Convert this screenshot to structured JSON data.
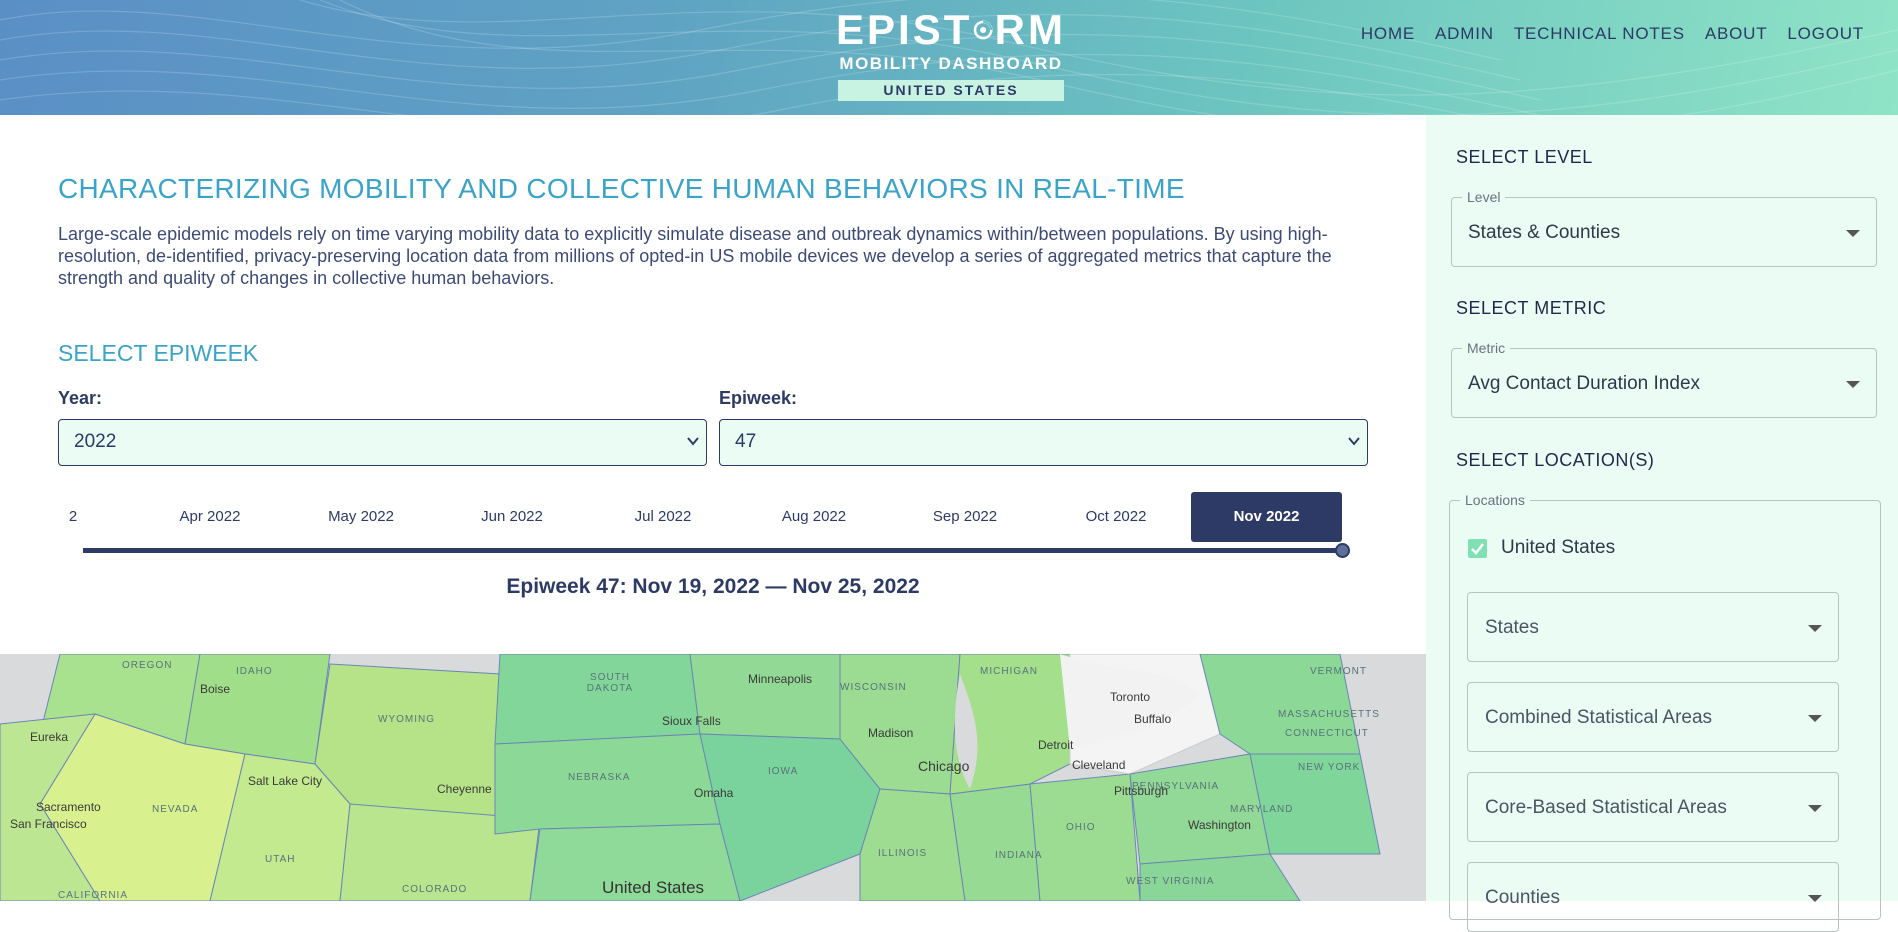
{
  "header": {
    "logo_title_left": "EPIST",
    "logo_title_right": "RM",
    "logo_subtitle": "MOBILITY DASHBOARD",
    "logo_country": "UNITED STATES",
    "nav": [
      "HOME",
      "ADMIN",
      "TECHNICAL NOTES",
      "ABOUT",
      "LOGOUT"
    ]
  },
  "main": {
    "headline": "CHARACTERIZING MOBILITY AND COLLECTIVE HUMAN BEHAVIORS IN REAL-TIME",
    "intro": "Large-scale epidemic models rely on time varying mobility data to explicitly simulate disease and outbreak dynamics within/between populations. By using high-resolution, de-identified, privacy-preserving location data from millions of opted-in US mobile devices we develop a series of aggregated metrics that capture the strength and quality of changes in collective human behaviors.",
    "select_epiweek_title": "SELECT EPIWEEK",
    "year_label": "Year:",
    "year_value": "2022",
    "epiweek_label": "Epiweek:",
    "epiweek_value": "47",
    "months": [
      "2",
      "Apr 2022",
      "May 2022",
      "Jun 2022",
      "Jul 2022",
      "Aug 2022",
      "Sep 2022",
      "Oct 2022",
      "Nov 2022"
    ],
    "active_month": "Nov 2022",
    "epiweek_range": "Epiweek 47: Nov 19, 2022 — Nov 25, 2022"
  },
  "map": {
    "cities": [
      "Minneapolis",
      "Sioux Falls",
      "Madison",
      "Chicago",
      "Detroit",
      "Toronto",
      "Buffalo",
      "Cleveland",
      "Pittsburgh",
      "Washington",
      "Omaha",
      "Boise",
      "Salt Lake City",
      "Cheyenne",
      "Eureka",
      "Sacramento",
      "San Francisco"
    ],
    "states": [
      "OREGON",
      "IDAHO",
      "WYOMING",
      "SOUTH DAKOTA",
      "NEBRASKA",
      "IOWA",
      "WISCONSIN",
      "MICHIGAN",
      "ILLINOIS",
      "INDIANA",
      "OHIO",
      "PENNSYLVANIA",
      "NEW YORK",
      "WEST VIRGINIA",
      "NEVADA",
      "UTAH",
      "COLORADO",
      "CALIFORNIA",
      "VERMONT",
      "MASSACHUSETTS",
      "CONNECTICUT",
      "MARYLAND"
    ],
    "country_label": "United States"
  },
  "sidebar": {
    "level_title": "SELECT LEVEL",
    "level_legend": "Level",
    "level_value": "States & Counties",
    "metric_title": "SELECT METRIC",
    "metric_legend": "Metric",
    "metric_value": "Avg Contact Duration Index",
    "location_title": "SELECT LOCATION(S)",
    "locations_legend": "Locations",
    "us_checkbox_label": "United States",
    "us_checked": true,
    "sub_selects": [
      "States",
      "Combined Statistical Areas",
      "Core-Based Statistical Areas",
      "Counties"
    ]
  },
  "colors": {
    "navy": "#2d3a66",
    "accent_blue": "#3aa3c9",
    "mint": "#eafcf3",
    "check_green": "#7fe0b4"
  }
}
